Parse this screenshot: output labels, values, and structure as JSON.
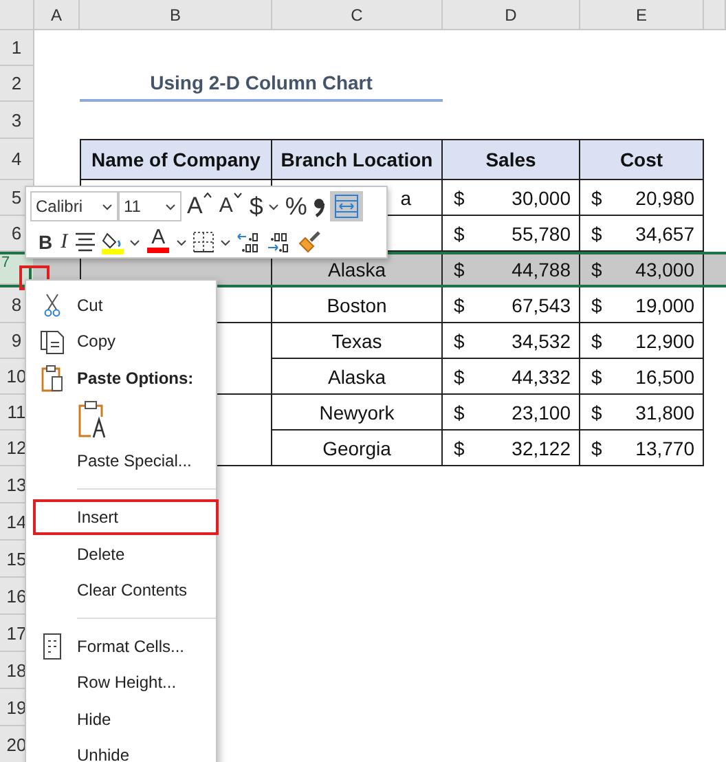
{
  "columns": [
    "A",
    "B",
    "C",
    "D",
    "E"
  ],
  "rows": [
    {
      "label": "1",
      "selected": false
    },
    {
      "label": "2",
      "selected": false
    },
    {
      "label": "3",
      "selected": false
    },
    {
      "label": "4",
      "selected": false
    },
    {
      "label": "5",
      "selected": false
    },
    {
      "label": "6",
      "selected": false
    },
    {
      "label": "7",
      "selected": true
    },
    {
      "label": "8",
      "selected": false
    },
    {
      "label": "9",
      "selected": false
    },
    {
      "label": "10",
      "selected": false
    },
    {
      "label": "11",
      "selected": false
    },
    {
      "label": "12",
      "selected": false
    },
    {
      "label": "13",
      "selected": false
    },
    {
      "label": "14",
      "selected": false
    },
    {
      "label": "15",
      "selected": false
    },
    {
      "label": "16",
      "selected": false
    },
    {
      "label": "17",
      "selected": false
    },
    {
      "label": "18",
      "selected": false
    },
    {
      "label": "19",
      "selected": false
    },
    {
      "label": "20",
      "selected": false
    }
  ],
  "title": "Using 2-D Column Chart",
  "table": {
    "columns": [
      "Name of Company",
      "Branch Location",
      "Sales",
      "Cost"
    ],
    "rows": [
      {
        "branch": "a",
        "sales": {
          "symbol": "$",
          "amount": "30,000"
        },
        "cost": {
          "symbol": "$",
          "amount": "20,980"
        },
        "selected": false
      },
      {
        "sales": {
          "symbol": "$",
          "amount": "55,780"
        },
        "cost": {
          "symbol": "$",
          "amount": "34,657"
        },
        "selected": false
      },
      {
        "branch": "Alaska",
        "sales": {
          "symbol": "$",
          "amount": "44,788"
        },
        "cost": {
          "symbol": "$",
          "amount": "43,000"
        },
        "selected": true
      },
      {
        "branch": "Boston",
        "sales": {
          "symbol": "$",
          "amount": "67,543"
        },
        "cost": {
          "symbol": "$",
          "amount": "19,000"
        },
        "selected": false
      },
      {
        "branch": "Texas",
        "sales": {
          "symbol": "$",
          "amount": "34,532"
        },
        "cost": {
          "symbol": "$",
          "amount": "12,900"
        },
        "selected": false
      },
      {
        "branch": "Alaska",
        "sales": {
          "symbol": "$",
          "amount": "44,332"
        },
        "cost": {
          "symbol": "$",
          "amount": "16,500"
        },
        "selected": false
      },
      {
        "branch": "Newyork",
        "sales": {
          "symbol": "$",
          "amount": "23,100"
        },
        "cost": {
          "symbol": "$",
          "amount": "31,800"
        },
        "selected": false
      },
      {
        "branch": "Georgia",
        "sales": {
          "symbol": "$",
          "amount": "32,122"
        },
        "cost": {
          "symbol": "$",
          "amount": "13,770"
        },
        "selected": false
      }
    ]
  },
  "mini_toolbar": {
    "font": "Calibri",
    "size": "11",
    "row_1": [
      {
        "kind": "grow",
        "label": "A"
      },
      {
        "kind": "shrink",
        "label": "A"
      },
      {
        "kind": "currency",
        "label": "$"
      },
      {
        "kind": "percent",
        "label": "%"
      },
      {
        "kind": "comma"
      },
      {
        "kind": "wrap",
        "selected": true
      }
    ],
    "row_2": [
      {
        "kind": "bold",
        "label": "B"
      },
      {
        "kind": "italic",
        "label": "I"
      },
      {
        "kind": "align"
      },
      {
        "kind": "fill",
        "color": "#ffff00"
      },
      {
        "kind": "font-color",
        "label": "A",
        "color": "#ff0000"
      },
      {
        "kind": "borders"
      },
      {
        "kind": "decrease-decimal"
      },
      {
        "kind": "increase-decimal"
      },
      {
        "kind": "painter"
      }
    ]
  },
  "context_menu": [
    {
      "kind": "item",
      "label": "Cut",
      "highlighted": false
    },
    {
      "kind": "item",
      "label": "Copy",
      "highlighted": false
    },
    {
      "kind": "header",
      "label": "Paste Options:"
    },
    {
      "kind": "paste-option"
    },
    {
      "kind": "item",
      "label": "Paste Special...",
      "highlighted": false
    },
    {
      "kind": "separator"
    },
    {
      "kind": "item",
      "label": "Insert",
      "highlighted": true
    },
    {
      "kind": "item",
      "label": "Delete",
      "highlighted": false
    },
    {
      "kind": "item",
      "label": "Clear Contents",
      "highlighted": false
    },
    {
      "kind": "separator"
    },
    {
      "kind": "item",
      "label": "Format Cells...",
      "highlighted": false
    },
    {
      "kind": "item",
      "label": "Row Height...",
      "highlighted": false
    },
    {
      "kind": "item",
      "label": "Hide",
      "highlighted": false
    },
    {
      "kind": "item",
      "label": "Unhide",
      "highlighted": false
    }
  ]
}
